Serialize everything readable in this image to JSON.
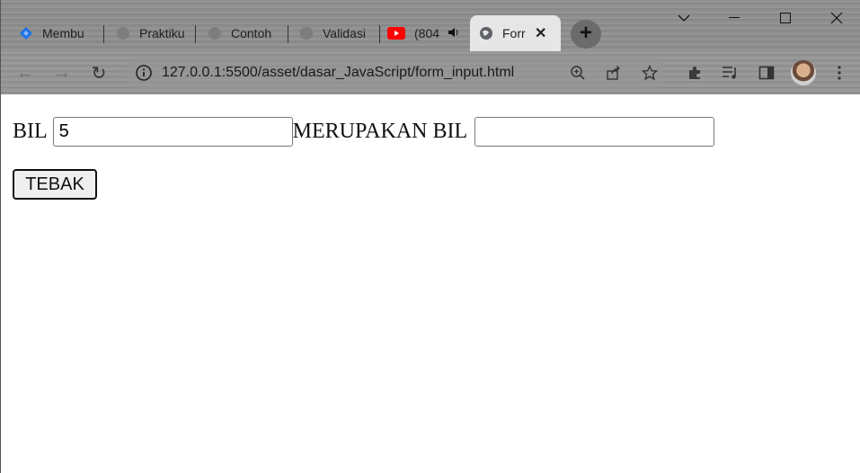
{
  "tabs": [
    {
      "label": "Membu",
      "icon": "blue-diamond-icon"
    },
    {
      "label": "Praktiku",
      "icon": "globe-icon"
    },
    {
      "label": "Contoh",
      "icon": "globe-icon"
    },
    {
      "label": "Validasi",
      "icon": "globe-icon"
    },
    {
      "label": "(804",
      "icon": "youtube-icon"
    },
    {
      "label": "Forr",
      "icon": "globe-icon"
    }
  ],
  "address": {
    "url": "127.0.0.1:5500/asset/dasar_JavaScript/form_input.html"
  },
  "form": {
    "label_bil": "BIL",
    "bil_value": "5",
    "label_merupakan": "MERUPAKAN BIL",
    "result_value": "",
    "submit_label": "TEBAK"
  },
  "colors": {
    "youtube": "#ff0000",
    "accent": "#1a73e8"
  }
}
